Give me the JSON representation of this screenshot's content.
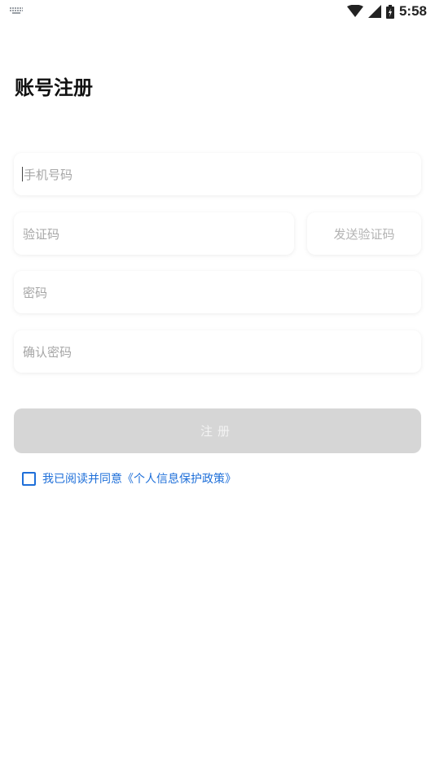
{
  "status_bar": {
    "time": "5:58",
    "icons": [
      "keyboard-icon",
      "wifi-icon",
      "signal-icon",
      "battery-icon"
    ]
  },
  "page": {
    "title": "账号注册"
  },
  "form": {
    "phone_placeholder": "手机号码",
    "code_placeholder": "验证码",
    "send_code_label": "发送验证码",
    "password_placeholder": "密码",
    "confirm_password_placeholder": "确认密码",
    "register_label": "注册"
  },
  "agreement": {
    "text": "我已阅读并同意《个人信息保护政策》",
    "checked": false
  },
  "colors": {
    "link": "#1e6fd9",
    "button_disabled": "#d6d6d6",
    "placeholder": "#a6a6a6"
  }
}
